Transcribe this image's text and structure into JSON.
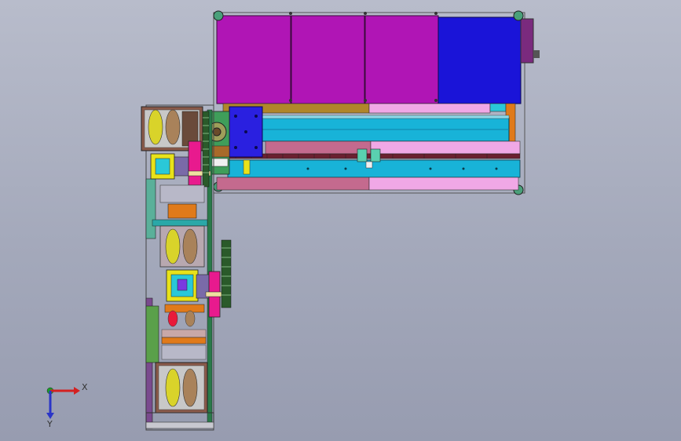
{
  "triad": {
    "x_label": "X",
    "y_label": "Y",
    "x_color": "#d42020",
    "y_color": "#2a35c8",
    "z_color": "#1a9e2a"
  },
  "colors": {
    "magenta_panel": "#b015b5",
    "blue_panel": "#1a14d8",
    "cyan_rail": "#18b3d8",
    "pink_plate": "#f0a8e6",
    "rose_plate": "#c46a8e",
    "olive_bar": "#b0862a",
    "orange_block": "#e07a1a",
    "green_frame": "#3f9e5a",
    "yellow_frame": "#e8e21a",
    "shoe_yellow": "#d9d32a",
    "shoe_brown": "#a9825a",
    "purple_strut": "#7a4a8e"
  }
}
